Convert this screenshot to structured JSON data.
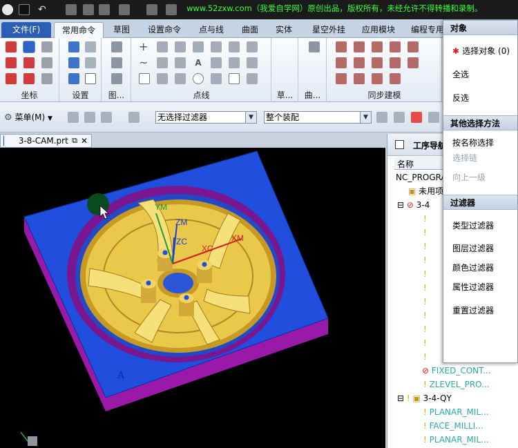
{
  "watermark": "www.52zxw.com（我爱自学网）原创出品，版权所有，未经允许不得转播和录制。",
  "tabs": [
    "文件(F)",
    "常用命令",
    "草图",
    "设置命令",
    "点与线",
    "曲面",
    "实体",
    "星空外挂",
    "应用模块",
    "编程专用"
  ],
  "ribbon_groups": {
    "coord": "坐标",
    "setup": "设置",
    "view": "图...",
    "points": "点线",
    "grass": "草...",
    "curve": "曲...",
    "sync": "同步建模"
  },
  "toolbar2": {
    "menu_label": "菜单(M)",
    "filter_value": "无选择过滤器",
    "assembly_value": "整个装配"
  },
  "document_tab": "3-8-CAM.prt",
  "viewport_labels": {
    "ym": "YM",
    "zm": "ZM",
    "zc": "ZC",
    "xc": "XC",
    "xm": "XM",
    "face_mark": "A"
  },
  "navigator": {
    "title": "工序导航",
    "column_name": "名称",
    "rows": [
      "NC_PROGRAM",
      "未用项",
      "3-4",
      "FIXED_CONT...",
      "ZLEVEL_PRO...",
      "3-4-QY",
      "PLANAR_MIL...",
      "FACE_MILLI...",
      "PLANAR_MIL..."
    ]
  },
  "popup": {
    "section_object": "对象",
    "select_objects": "选择对象 (0)",
    "select_all": "全选",
    "invert": "反选",
    "section_other": "其他选择方法",
    "by_name": "按名称选择",
    "select_chain": "选择链",
    "up_one_level": "向上一级",
    "section_filter": "过滤器",
    "type_filter": "类型过滤器",
    "layer_filter": "图层过滤器",
    "color_filter": "颜色过滤器",
    "attribute_filter": "属性过滤器",
    "reset_filter": "重置过滤器"
  },
  "colors": {
    "part_blue": "#1f4fdc",
    "part_side": "#9a19a8",
    "wheel_yellow": "#e9c84a",
    "accent_tab": "#2b5eb4",
    "watermark_green": "#34ff3a"
  }
}
